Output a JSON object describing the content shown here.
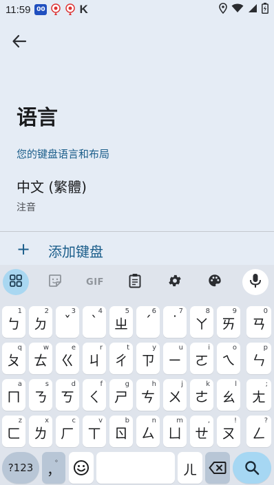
{
  "status_bar": {
    "time": "11:59",
    "app_icon_1_text": "00",
    "app_icon_k": "K",
    "icons": [
      "notification-app-icon",
      "location-pin-icon",
      "location-pin-icon",
      "k-app-icon",
      "location-icon",
      "wifi-icon",
      "signal-icon",
      "battery-icon"
    ]
  },
  "page": {
    "title": "语言",
    "section_header": "您的键盘语言和布局",
    "language": {
      "name": "中文 (繁體)",
      "layout": "注音"
    },
    "add_keyboard_icon": "+",
    "add_keyboard_label": "添加键盘"
  },
  "keyboard": {
    "toolbar": {
      "gif_label": "GIF",
      "items": [
        "apps-grid-icon",
        "sticker-icon",
        "gif-icon",
        "clipboard-icon",
        "settings-gear-icon",
        "theme-palette-icon",
        "microphone-icon"
      ]
    },
    "rows": [
      [
        {
          "label": "ㄅ",
          "hint": "1"
        },
        {
          "label": "ㄉ",
          "hint": "2"
        },
        {
          "label": "ˇ",
          "hint": "3"
        },
        {
          "label": "ˋ",
          "hint": "4"
        },
        {
          "label": "ㄓ",
          "hint": "5"
        },
        {
          "label": "ˊ",
          "hint": "6"
        },
        {
          "label": "˙",
          "hint": "7"
        },
        {
          "label": "ㄚ",
          "hint": "8"
        },
        {
          "label": "ㄞ",
          "hint": "9"
        },
        {
          "label": "ㄢ",
          "hint": "0"
        }
      ],
      [
        {
          "label": "ㄆ",
          "hint": "q"
        },
        {
          "label": "ㄊ",
          "hint": "w"
        },
        {
          "label": "ㄍ",
          "hint": "e"
        },
        {
          "label": "ㄐ",
          "hint": "r"
        },
        {
          "label": "ㄔ",
          "hint": "t"
        },
        {
          "label": "ㄗ",
          "hint": "y"
        },
        {
          "label": "ㄧ",
          "hint": "u"
        },
        {
          "label": "ㄛ",
          "hint": "i"
        },
        {
          "label": "ㄟ",
          "hint": "o"
        },
        {
          "label": "ㄣ",
          "hint": "p"
        }
      ],
      [
        {
          "label": "ㄇ",
          "hint": "a"
        },
        {
          "label": "ㄋ",
          "hint": "s"
        },
        {
          "label": "ㄎ",
          "hint": "d"
        },
        {
          "label": "ㄑ",
          "hint": "f"
        },
        {
          "label": "ㄕ",
          "hint": "g"
        },
        {
          "label": "ㄘ",
          "hint": "h"
        },
        {
          "label": "ㄨ",
          "hint": "j"
        },
        {
          "label": "ㄜ",
          "hint": "k"
        },
        {
          "label": "ㄠ",
          "hint": "l"
        },
        {
          "label": "ㄤ",
          "hint": ";"
        }
      ],
      [
        {
          "label": "ㄈ",
          "hint": "z"
        },
        {
          "label": "ㄌ",
          "hint": "x"
        },
        {
          "label": "ㄏ",
          "hint": "c"
        },
        {
          "label": "ㄒ",
          "hint": "v"
        },
        {
          "label": "ㄖ",
          "hint": "b"
        },
        {
          "label": "ㄙ",
          "hint": "n"
        },
        {
          "label": "ㄩ",
          "hint": "m"
        },
        {
          "label": "ㄝ",
          "hint": ","
        },
        {
          "label": "ㄡ",
          "hint": "!"
        },
        {
          "label": "ㄥ",
          "hint": "?"
        }
      ]
    ],
    "bottom": {
      "symbols_label": "?123",
      "comma_label": "，",
      "comma_hint": "。",
      "emoji_icon": "emoji-icon",
      "space_label": "",
      "er_label": "ㄦ",
      "backspace_icon": "backspace-icon",
      "search_icon": "search-icon"
    }
  }
}
